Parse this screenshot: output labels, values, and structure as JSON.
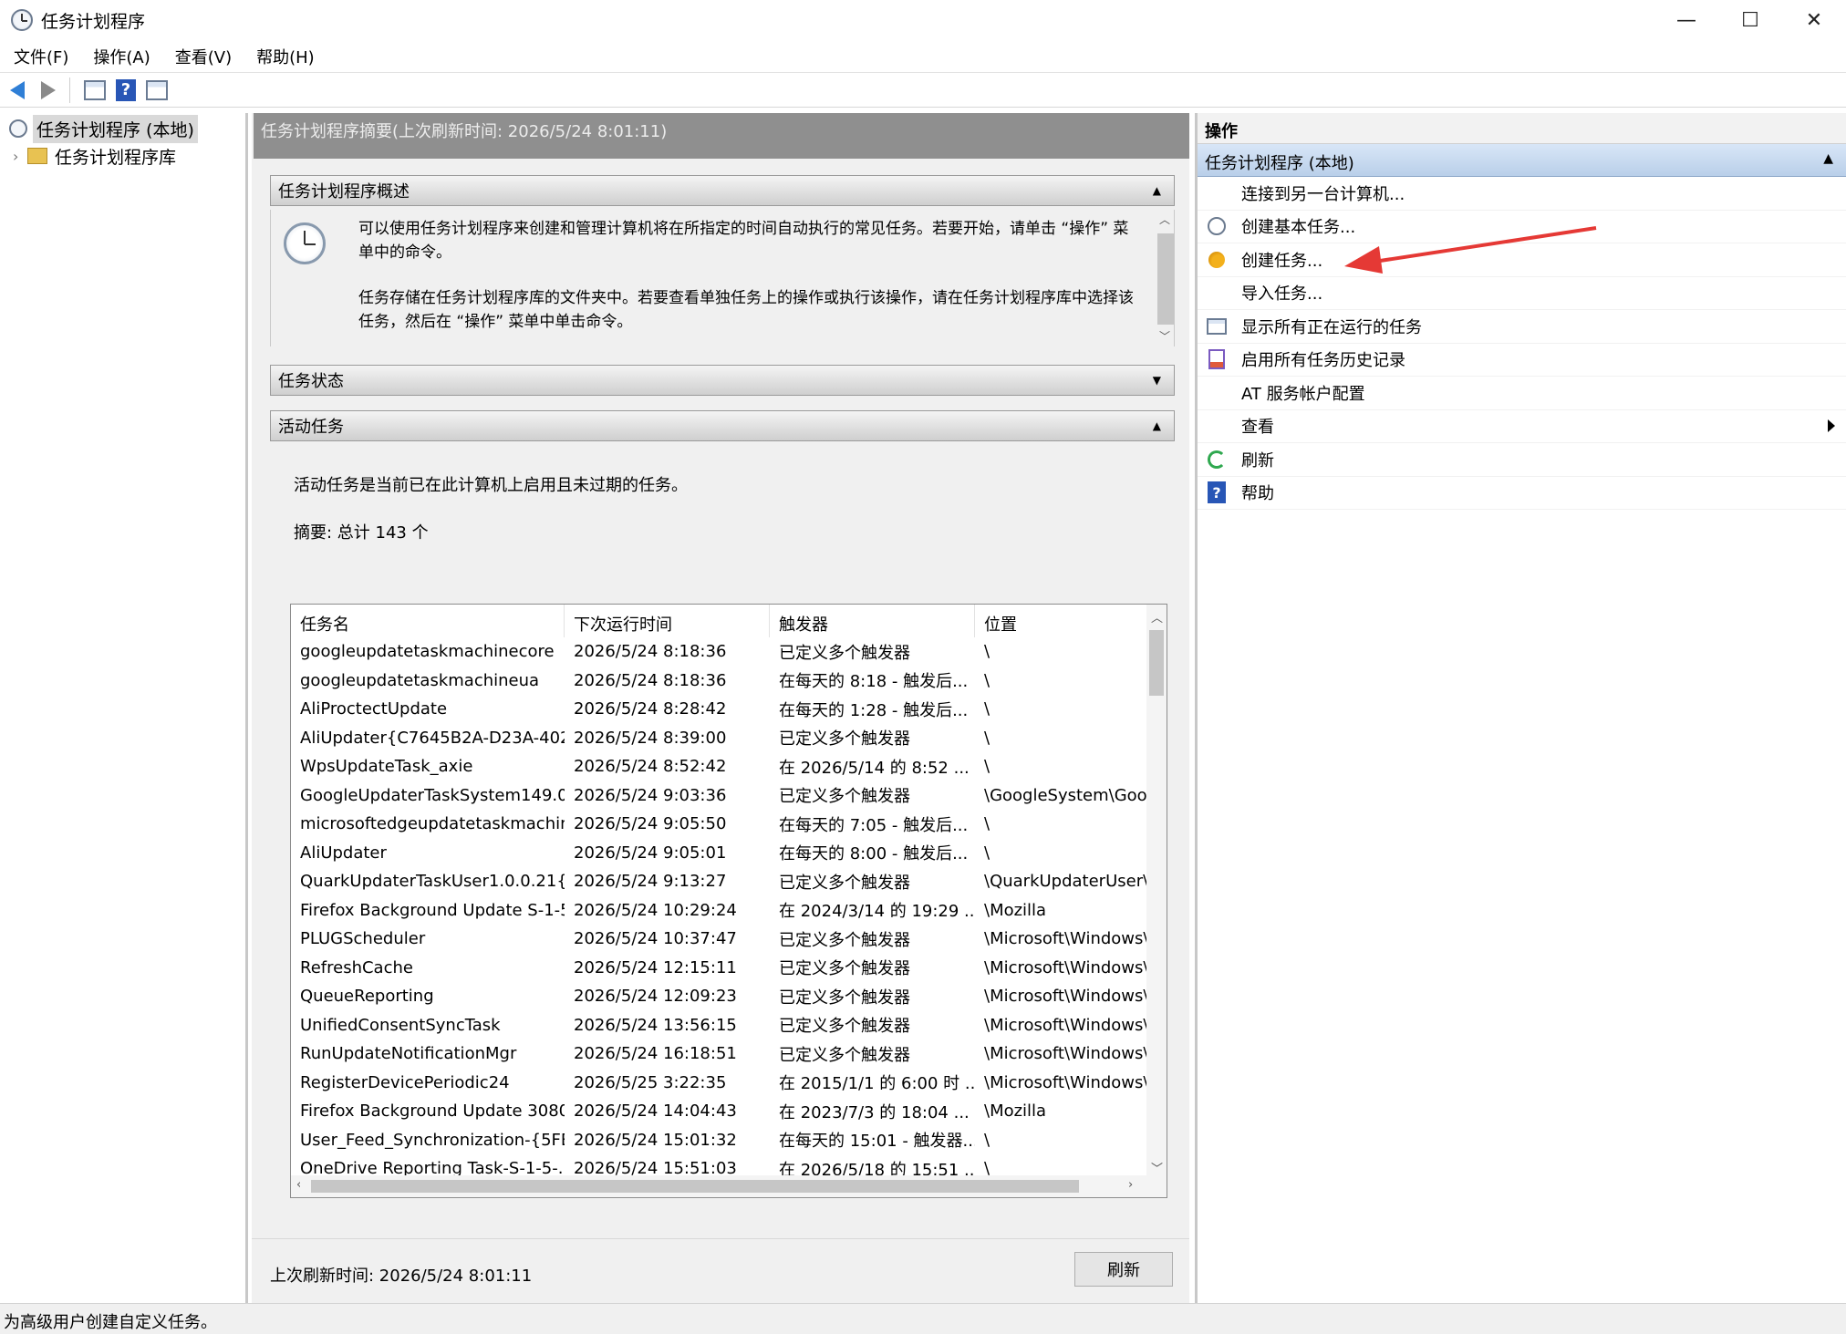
{
  "window": {
    "title": "任务计划程序",
    "controls": {
      "minimize": "—",
      "maximize": "☐",
      "close": "✕"
    }
  },
  "menu": [
    "文件(F)",
    "操作(A)",
    "查看(V)",
    "帮助(H)"
  ],
  "toolbar": {
    "help_glyph": "?"
  },
  "tree": {
    "root": "任务计划程序 (本地)",
    "child": "任务计划程序库",
    "chevron": "›"
  },
  "center": {
    "header": "任务计划程序摘要(上次刷新时间: 2026/5/24 8:01:11)",
    "overview": {
      "title": "任务计划程序概述",
      "para1": "可以使用任务计划程序来创建和管理计算机将在所指定的时间自动执行的常见任务。若要开始，请单击 “操作” 菜单中的命令。",
      "para2": "任务存储在任务计划程序库的文件夹中。若要查看单独任务上的操作或执行该操作，请在任务计划程序库中选择该任务，然后在 “操作” 菜单中单击命令。"
    },
    "status_section": {
      "title": "任务状态"
    },
    "active_section": {
      "title": "活动任务",
      "description": "活动任务是当前已在此计算机上启用且未过期的任务。",
      "summary": "摘要: 总计 143 个"
    },
    "table": {
      "columns": [
        "任务名",
        "下次运行时间",
        "触发器",
        "位置"
      ],
      "rows": [
        [
          "googleupdatetaskmachinecore",
          "2026/5/24 8:18:36",
          "已定义多个触发器",
          "\\"
        ],
        [
          "googleupdatetaskmachineua",
          "2026/5/24 8:18:36",
          "在每天的 8:18 - 触发后...",
          "\\"
        ],
        [
          "AliProctectUpdate",
          "2026/5/24 8:28:42",
          "在每天的 1:28 - 触发后...",
          "\\"
        ],
        [
          "AliUpdater{C7645B2A-D23A-402...",
          "2026/5/24 8:39:00",
          "已定义多个触发器",
          "\\"
        ],
        [
          "WpsUpdateTask_axie",
          "2026/5/24 8:52:42",
          "在 2026/5/14 的 8:52 ...",
          "\\"
        ],
        [
          "GoogleUpdaterTaskSystem149.0....",
          "2026/5/24 9:03:36",
          "已定义多个触发器",
          "\\GoogleSystem\\Goog"
        ],
        [
          "microsoftedgeupdatetaskmachin...",
          "2026/5/24 9:05:50",
          "在每天的 7:05 - 触发后...",
          "\\"
        ],
        [
          "AliUpdater",
          "2026/5/24 9:05:01",
          "在每天的 8:00 - 触发后...",
          "\\"
        ],
        [
          "QuarkUpdaterTaskUser1.0.0.21{F...",
          "2026/5/24 9:13:27",
          "已定义多个触发器",
          "\\QuarkUpdaterUser\\("
        ],
        [
          "Firefox Background Update S-1-5...",
          "2026/5/24 10:29:24",
          "在 2024/3/14 的 19:29 ...",
          "\\Mozilla"
        ],
        [
          "PLUGScheduler",
          "2026/5/24 10:37:47",
          "已定义多个触发器",
          "\\Microsoft\\Windows\\"
        ],
        [
          "RefreshCache",
          "2026/5/24 12:15:11",
          "已定义多个触发器",
          "\\Microsoft\\Windows\\"
        ],
        [
          "QueueReporting",
          "2026/5/24 12:09:23",
          "已定义多个触发器",
          "\\Microsoft\\Windows\\"
        ],
        [
          "UnifiedConsentSyncTask",
          "2026/5/24 13:56:15",
          "已定义多个触发器",
          "\\Microsoft\\Windows\\"
        ],
        [
          "RunUpdateNotificationMgr",
          "2026/5/24 16:18:51",
          "已定义多个触发器",
          "\\Microsoft\\Windows\\"
        ],
        [
          "RegisterDevicePeriodic24",
          "2026/5/25 3:22:35",
          "在 2015/1/1 的 6:00 时 ...",
          "\\Microsoft\\Windows\\"
        ],
        [
          "Firefox Background Update 3080...",
          "2026/5/24 14:04:43",
          "在 2023/7/3 的 18:04 ...",
          "\\Mozilla"
        ],
        [
          "User_Feed_Synchronization-{5FE...",
          "2026/5/24 15:01:32",
          "在每天的 15:01 - 触发器...",
          "\\"
        ],
        [
          "OneDrive Reporting Task-S-1-5-...",
          "2026/5/24 15:51:03",
          "在 2026/5/18 的 15:51 ...",
          "\\"
        ]
      ]
    },
    "footer": {
      "last_refresh": "上次刷新时间: 2026/5/24 8:01:11",
      "refresh_button": "刷新"
    }
  },
  "actions": {
    "title": "操作",
    "section": "任务计划程序 (本地)",
    "items": [
      {
        "label": "连接到另一台计算机...",
        "icon": "none"
      },
      {
        "label": "创建基本任务...",
        "icon": "clock-icon"
      },
      {
        "label": "创建任务...",
        "icon": "task-icon"
      },
      {
        "label": "导入任务...",
        "icon": "none"
      },
      {
        "label": "显示所有正在运行的任务",
        "icon": "running-tasks-icon"
      },
      {
        "label": "启用所有任务历史记录",
        "icon": "history-icon"
      },
      {
        "label": "AT 服务帐户配置",
        "icon": "none"
      },
      {
        "label": "查看",
        "icon": "none"
      },
      {
        "label": "刷新",
        "icon": "refresh-icon"
      },
      {
        "label": "帮助",
        "icon": "help-icon"
      }
    ]
  },
  "annotation": {
    "color": "#e53935"
  },
  "statusbar": "为高级用户创建自定义任务。"
}
